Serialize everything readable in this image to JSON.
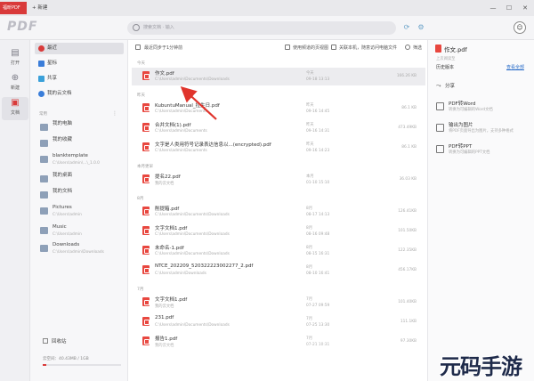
{
  "tabbar": {
    "active_tab": "福昕PDF",
    "new_tab": "+ 新建",
    "controls": [
      "—",
      "☐",
      "✕"
    ]
  },
  "header": {
    "logo": "PDF",
    "search_placeholder": "搜索文档 · 输入"
  },
  "rail": [
    {
      "label": "打开",
      "icon": "folder-open-icon"
    },
    {
      "label": "新建",
      "icon": "plus-circle-icon"
    },
    {
      "label": "文档",
      "icon": "document-icon",
      "active": true
    }
  ],
  "sidebar": {
    "items": [
      {
        "label": "最近",
        "color": "#d93a3a",
        "active": true
      },
      {
        "label": "星标",
        "color": "#3a7dd9"
      },
      {
        "label": "共享",
        "color": "#3aa0d9"
      },
      {
        "label": "我的云文档",
        "color": "#3a7dd9"
      }
    ],
    "section_label": "常用",
    "folders": [
      {
        "name": "我的电脑",
        "path": ""
      },
      {
        "name": "我的收藏",
        "path": ""
      },
      {
        "name": "blanktemplate",
        "path": "C:\\Users\\admin\\...\\_1.0.0"
      },
      {
        "name": "我的桌面",
        "path": ""
      },
      {
        "name": "我的文档",
        "path": ""
      },
      {
        "name": "Pictures",
        "path": "C:\\Users\\admin"
      },
      {
        "name": "Music",
        "path": "C:\\Users\\admin"
      },
      {
        "name": "Downloads",
        "path": "C:\\Users\\admin\\Downloads"
      }
    ],
    "recycle": "回收站",
    "storage": "云空间：40.43MB / 1GB",
    "storage_fraction": 0.04
  },
  "toolbar": {
    "left": "最近同步于1分钟前",
    "right": [
      "使用频道的页视图",
      "关联本机，随意访问电脑文件",
      "筛选"
    ]
  },
  "groups": [
    {
      "label": "今天",
      "rows": [
        {
          "name": "作文.pdf",
          "path": "C:\\Users\\admin\\Documents\\Downloads",
          "date": "今天",
          "time": "09-18 13:13",
          "size": "166.26 KB",
          "highlight": true
        }
      ]
    },
    {
      "label": "昨天",
      "rows": [
        {
          "name": "KubuntuManual_拉生日.pdf",
          "path": "C:\\Users\\admin\\Documents",
          "date": "昨天",
          "time": "09-16 14:45",
          "size": "86.1 KB"
        },
        {
          "name": "合并文档(1).pdf",
          "path": "C:\\Users\\admin\\Documents",
          "date": "昨天",
          "time": "09-16 14:31",
          "size": "473.49KB"
        },
        {
          "name": "文字是人类用符号记录表达信息以...(encrypted).pdf",
          "path": "C:\\Users\\admin\\Documents",
          "date": "昨天",
          "time": "09-16 14:23",
          "size": "86.1 KB"
        }
      ]
    },
    {
      "label": "本月更早",
      "rows": [
        {
          "name": "提名22.pdf",
          "path": "我的云文档",
          "date": "本月",
          "time": "01-10 15:10",
          "size": "36.03 KB"
        }
      ]
    },
    {
      "label": "8月",
      "rows": [
        {
          "name": "削提箱.pdf",
          "path": "C:\\Users\\admin\\Documents\\Downloads",
          "date": "8月",
          "time": "08-17 14:13",
          "size": "126.41KB"
        },
        {
          "name": "文字文档1.pdf",
          "path": "C:\\Users\\admin\\Documents\\Downloads",
          "date": "8月",
          "time": "08-16 09:48",
          "size": "101.50KB"
        },
        {
          "name": "未命名-1.pdf",
          "path": "C:\\Users\\admin\\Documents\\Downloads",
          "date": "8月",
          "time": "08-15 16:31",
          "size": "122.35KB"
        },
        {
          "name": "NTCE_202209_520322223002277_2.pdf",
          "path": "C:\\Users\\admin\\Downloads",
          "date": "8月",
          "time": "08-10 16:41",
          "size": "456.17KB"
        }
      ]
    },
    {
      "label": "7月",
      "rows": [
        {
          "name": "文字文档1.pdf",
          "path": "我的云文档",
          "date": "7月",
          "time": "07-27 09:59",
          "size": "101.40KB"
        },
        {
          "name": "231.pdf",
          "path": "C:\\Users\\admin\\Documents\\Downloads",
          "date": "7月",
          "time": "07-25 13:30",
          "size": "111.1KB"
        },
        {
          "name": "报告1.pdf",
          "path": "我的云文档",
          "date": "7月",
          "time": "07-21 10:31",
          "size": "97.30KB"
        }
      ]
    }
  ],
  "rpanel": {
    "title": "作文.pdf",
    "subtitle": "上次阅读至",
    "history_label": "历史版本",
    "history_link": "查看全部",
    "share": "分享",
    "tools": [
      {
        "name": "PDF转Word",
        "desc": "转换为可编辑的Word文档"
      },
      {
        "name": "输出为图片",
        "desc": "将PDF页面导出为图片，支持多种格式"
      },
      {
        "name": "PDF转PPT",
        "desc": "转换为可编辑的PPT文档"
      }
    ]
  },
  "watermark": "元码手游网",
  "colors": {
    "accent": "#d93a3a",
    "pdf": "#e8473f",
    "link": "#2a6dc9"
  }
}
